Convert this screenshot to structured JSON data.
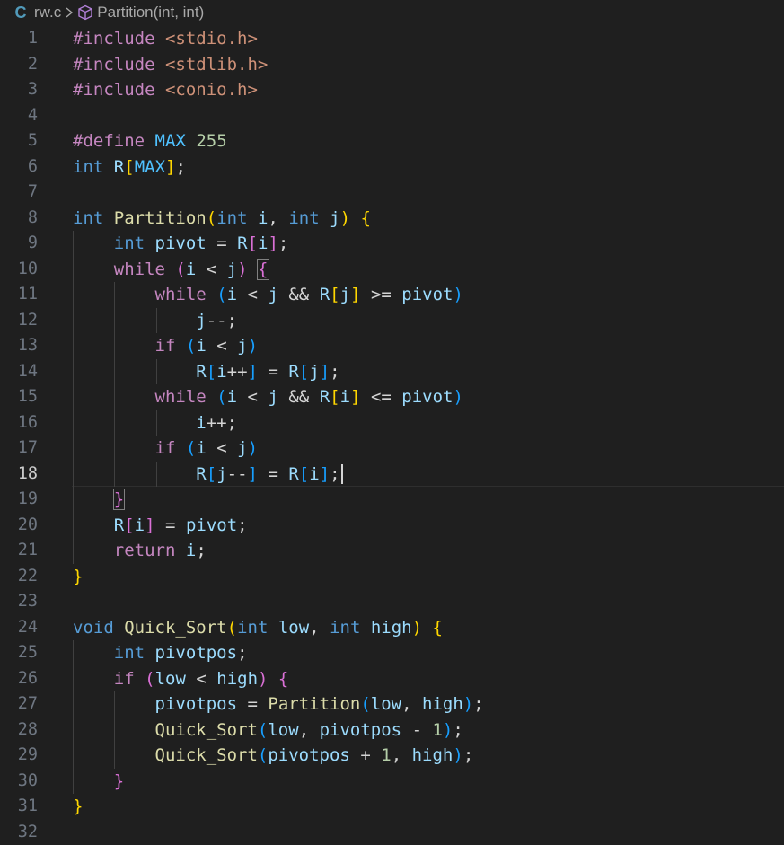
{
  "breadcrumb": {
    "language_icon": "C",
    "file": "rw.c",
    "symbol": "Partition(int, int)"
  },
  "editor": {
    "active_line": 18,
    "line_numbers": [
      "1",
      "2",
      "3",
      "4",
      "5",
      "6",
      "7",
      "8",
      "9",
      "10",
      "11",
      "12",
      "13",
      "14",
      "15",
      "16",
      "17",
      "18",
      "19",
      "20",
      "21",
      "22",
      "23",
      "24",
      "25",
      "26",
      "27",
      "28",
      "29",
      "30",
      "31",
      "32"
    ],
    "code_lines": [
      "#include <stdio.h>",
      "#include <stdlib.h>",
      "#include <conio.h>",
      "",
      "#define MAX 255",
      "int R[MAX];",
      "",
      "int Partition(int i, int j) {",
      "    int pivot = R[i];",
      "    while (i < j) {",
      "        while (i < j && R[j] >= pivot)",
      "            j--;",
      "        if (i < j)",
      "            R[i++] = R[j];",
      "        while (i < j && R[i] <= pivot)",
      "            i++;",
      "        if (i < j)",
      "            R[j--] = R[i];",
      "    }",
      "    R[i] = pivot;",
      "    return i;",
      "}",
      "",
      "void Quick_Sort(int low, int high) {",
      "    int pivotpos;",
      "    if (low < high) {",
      "        pivotpos = Partition(low, high);",
      "        Quick_Sort(low, pivotpos - 1);",
      "        Quick_Sort(pivotpos + 1, high);",
      "    }",
      "}",
      ""
    ]
  }
}
